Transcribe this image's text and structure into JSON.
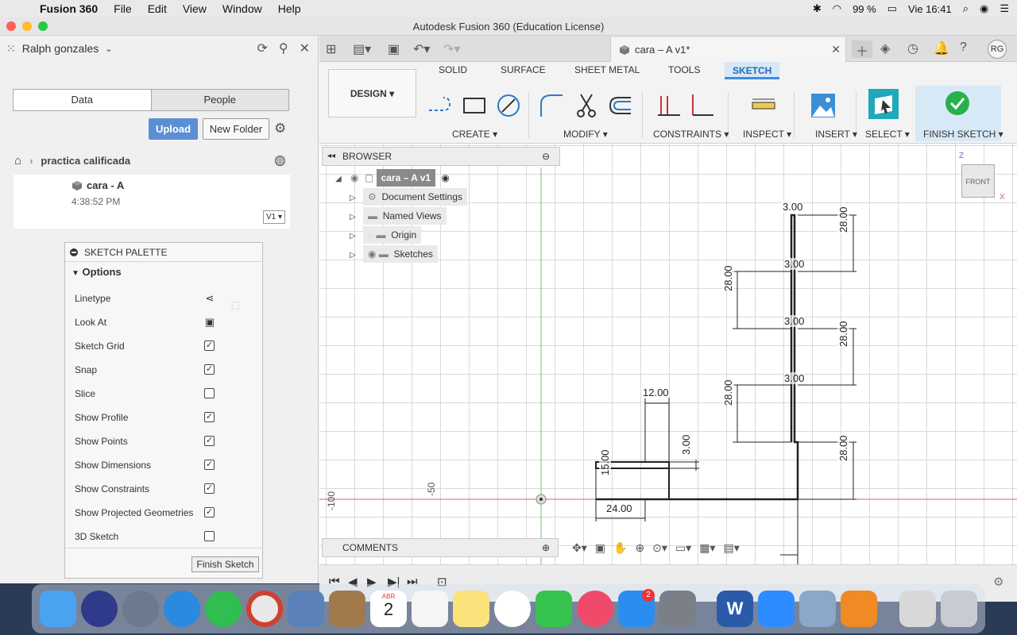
{
  "menubar": {
    "app": "Fusion 360",
    "items": [
      "File",
      "Edit",
      "View",
      "Window",
      "Help"
    ],
    "battery": "99 %",
    "clock": "Vie 16:41"
  },
  "window": {
    "title": "Autodesk Fusion 360 (Education License)"
  },
  "data_panel": {
    "user": "Ralph gonzales",
    "tabs": [
      "Data",
      "People"
    ],
    "upload": "Upload",
    "new_folder": "New Folder",
    "breadcrumb": "practica calificada",
    "file": {
      "name": "cara - A",
      "time": "4:38:52 PM",
      "version": "V1 ▾"
    }
  },
  "palette": {
    "title": "SKETCH PALETTE",
    "section": "Options",
    "rows": [
      {
        "label": "Linetype",
        "kind": "icon"
      },
      {
        "label": "Look At",
        "kind": "icon"
      },
      {
        "label": "Sketch Grid",
        "kind": "check",
        "checked": true
      },
      {
        "label": "Snap",
        "kind": "check",
        "checked": true
      },
      {
        "label": "Slice",
        "kind": "check",
        "checked": false
      },
      {
        "label": "Show Profile",
        "kind": "check",
        "checked": true
      },
      {
        "label": "Show Points",
        "kind": "check",
        "checked": true
      },
      {
        "label": "Show Dimensions",
        "kind": "check",
        "checked": true
      },
      {
        "label": "Show Constraints",
        "kind": "check",
        "checked": true
      },
      {
        "label": "Show Projected Geometries",
        "kind": "check",
        "checked": true
      },
      {
        "label": "3D Sketch",
        "kind": "check",
        "checked": false
      }
    ],
    "finish": "Finish Sketch"
  },
  "doc": {
    "tab_title": "cara – A v1*"
  },
  "toolbar": {
    "design": "DESIGN ▾",
    "workspaces": [
      "SOLID",
      "SURFACE",
      "SHEET METAL",
      "TOOLS",
      "SKETCH"
    ],
    "groups": [
      "CREATE ▾",
      "MODIFY ▾",
      "CONSTRAINTS ▾",
      "INSPECT ▾",
      "INSERT ▾",
      "SELECT ▾",
      "FINISH SKETCH ▾"
    ]
  },
  "browser": {
    "title": "BROWSER",
    "root": "cara – A v1",
    "items": [
      "Document Settings",
      "Named Views",
      "Origin",
      "Sketches"
    ]
  },
  "comments": "COMMENTS",
  "viewcube": {
    "face": "FRONT",
    "z": "Z",
    "x": "X"
  },
  "sketch": {
    "dims": [
      "3.00",
      "28.00",
      "3.00",
      "28.00",
      "3.00",
      "28.00",
      "3.00",
      "28.00",
      "28.00",
      "12.00",
      "3.00",
      "15.00",
      "24.00"
    ],
    "rulers": [
      "-100",
      "-50"
    ]
  },
  "dock": {
    "calendar_month": "ABR",
    "calendar_day": "2",
    "appstore_badge": "2"
  },
  "colors": {
    "accent": "#3b8fde",
    "upload": "#5b8fd2",
    "finish": "#28b04a"
  }
}
